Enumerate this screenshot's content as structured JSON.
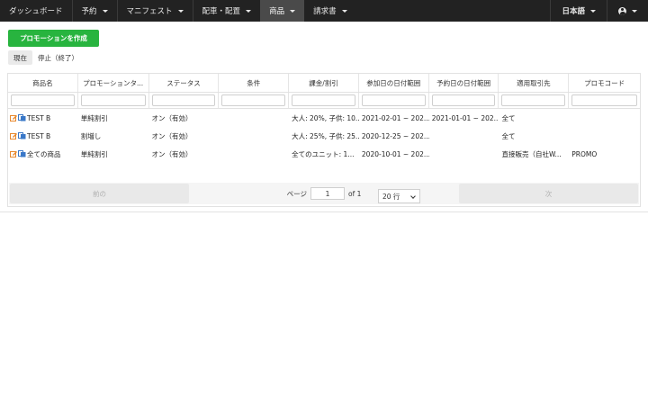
{
  "nav": {
    "items": [
      {
        "label": "ダッシュボード",
        "dropdown": false,
        "active": false
      },
      {
        "label": "予約",
        "dropdown": true,
        "active": false
      },
      {
        "label": "マニフェスト",
        "dropdown": true,
        "active": false
      },
      {
        "label": "配車・配置",
        "dropdown": true,
        "active": false
      },
      {
        "label": "商品",
        "dropdown": true,
        "active": true
      },
      {
        "label": "請求書",
        "dropdown": true,
        "active": false
      }
    ],
    "language": "日本語",
    "user_icon": "user-circle-icon"
  },
  "create_button": "プロモーションを作成",
  "tabs": [
    {
      "label": "現在",
      "active": true
    },
    {
      "label": "停止（終了）",
      "active": false
    }
  ],
  "table": {
    "columns": [
      "商品名",
      "プロモーションタ...",
      "ステータス",
      "条件",
      "課金/割引",
      "参加日の日付範囲",
      "予約日の日付範囲",
      "適用取引先",
      "プロモコード"
    ],
    "rows": [
      [
        "TEST B",
        "単純割引",
        "オン（有効）",
        "",
        "大人: 20%, 子供: 10...",
        "2021-02-01 ~ 202...",
        "2021-01-01 ~ 202...",
        "全て",
        ""
      ],
      [
        "TEST B",
        "割増し",
        "オン（有効）",
        "",
        "大人: 25%, 子供: 25...",
        "2020-12-25 ~ 202...",
        "",
        "全て",
        ""
      ],
      [
        "全ての商品",
        "単純割引",
        "オン（有効）",
        "",
        "全てのユニット: 1...",
        "2020-10-01 ~ 202...",
        "",
        "直接販売（自社W...",
        "PROMO"
      ]
    ]
  },
  "pagination": {
    "prev": "前の",
    "next": "次",
    "page_label": "ページ",
    "page_value": "1",
    "of_label": "of 1",
    "rows_select": "20 行"
  },
  "colors": {
    "navbar": "#222222",
    "nav_active": "#4a4a4a",
    "create_button": "#28b43f",
    "edit_icon": "#e8872b",
    "copy_icon": "#3a78c8"
  }
}
